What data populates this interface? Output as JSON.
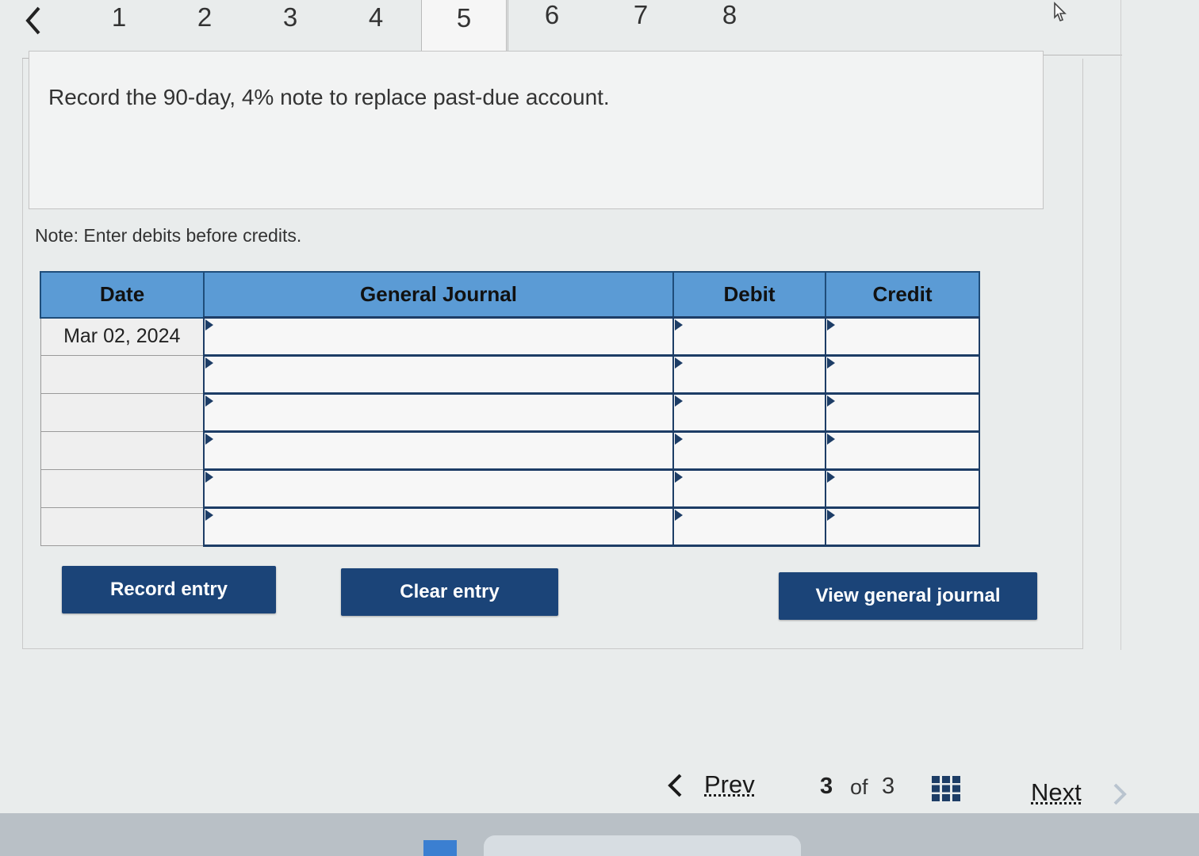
{
  "tabs": {
    "items": [
      {
        "label": "1"
      },
      {
        "label": "2"
      },
      {
        "label": "3"
      },
      {
        "label": "4"
      },
      {
        "label": "5"
      },
      {
        "label": "6"
      },
      {
        "label": "7"
      },
      {
        "label": "8"
      }
    ],
    "active_label": "5"
  },
  "prompt": {
    "text": "Record the 90-day, 4% note to replace past-due account."
  },
  "note": {
    "text": "Note: Enter debits before credits."
  },
  "journal": {
    "headers": {
      "date": "Date",
      "general_journal": "General Journal",
      "debit": "Debit",
      "credit": "Credit"
    },
    "rows": [
      {
        "date": "Mar 02, 2024",
        "account": "",
        "debit": "",
        "credit": ""
      },
      {
        "date": "",
        "account": "",
        "debit": "",
        "credit": ""
      },
      {
        "date": "",
        "account": "",
        "debit": "",
        "credit": ""
      },
      {
        "date": "",
        "account": "",
        "debit": "",
        "credit": ""
      },
      {
        "date": "",
        "account": "",
        "debit": "",
        "credit": ""
      },
      {
        "date": "",
        "account": "",
        "debit": "",
        "credit": ""
      }
    ]
  },
  "actions": {
    "record_label": "Record entry",
    "clear_label": "Clear entry",
    "view_label": "View general journal"
  },
  "pager": {
    "prev_label": "Prev",
    "current": "3",
    "of_label": "of",
    "total": "3",
    "next_label": "Next"
  },
  "colors": {
    "header_blue": "#5b9bd5",
    "button_navy": "#1b4478",
    "grid_navy": "#1d3d66"
  }
}
